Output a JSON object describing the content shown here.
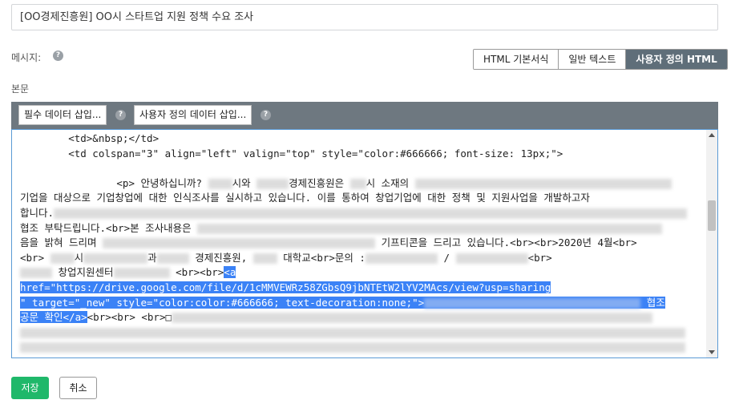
{
  "subject": {
    "value": "[OO경제진흥원] OO시 스타트업 지원 정책 수요 조사"
  },
  "message": {
    "label": "메시지:"
  },
  "mode_tabs": [
    {
      "label": "HTML 기본서식",
      "active": false
    },
    {
      "label": "일반 텍스트",
      "active": false
    },
    {
      "label": "사용자 정의 HTML",
      "active": true
    }
  ],
  "body": {
    "label": "본문"
  },
  "toolbar": {
    "required_data_label": "필수 데이터 삽입...",
    "custom_data_label": "사용자 정의 데이터 삽입..."
  },
  "code": {
    "line1": "        <td>&nbsp;</td>",
    "line2": "        <td colspan=\"3\" align=\"left\" valign=\"top\" style=\"color:#666666; font-size: 13px;\">",
    "line3": "",
    "line4a": "                <p> 안녕하십니까? ",
    "line4b": "시와 ",
    "line4c": "경제진흥원은 ",
    "line4d": "시 소재의 ",
    "line5": "기업을 대상으로 기업창업에 대한 인식조사를 실시하고 있습니다. 이를 통하여 창업기업에 대한 정책 및 지원사업을 개발하고자",
    "line6": "합니다.",
    "line7a": "협조 부탁드립니다.<br>본 조사내용은 ",
    "line8a": "음을 밝혀 드리며 ",
    "line8b": "기프티콘을 드리고 있습니다.<br><br>2020년 4월<br>",
    "line9a": "<br>",
    "line9b": "시",
    "line9c": "과",
    "line9d": "경제진흥원,",
    "line9e": "대학교<br>문의 :",
    "line9f": "/",
    "line9g": "<br>",
    "line10a": "창업지원센터",
    "line10b": "<br><br>",
    "line10c": "<a",
    "line11": "href=\"https://drive.google.com/file/d/1cMMVEWRz58ZGbsQ9jbNTEtW2lYV2MAcs/view?usp=sharing",
    "line12a": "\" target=\"_new\" style=\"color:color:#666666; text-decoration:none;\">",
    "line12b": "협조",
    "line13a": "공문 확인</a>",
    "line13b": "<br><br> <br>□"
  },
  "actions": {
    "save_label": "저장",
    "cancel_label": "취소"
  },
  "colors": {
    "save_bg": "#1fb86a",
    "toolbar_bg": "#6e7880",
    "active_tab_bg": "#5f6e79",
    "highlight": "#3b82f6"
  }
}
